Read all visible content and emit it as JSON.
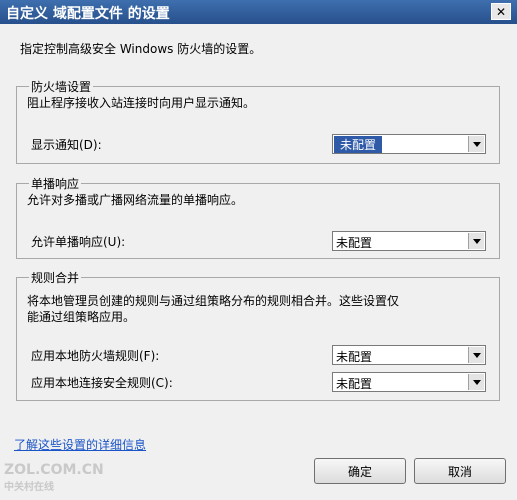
{
  "window": {
    "title": "自定义 域配置文件 的设置",
    "close_glyph": "✕"
  },
  "description": "指定控制高级安全 Windows 防火墙的设置。",
  "groups": [
    {
      "title": "防火墙设置",
      "description": "阻止程序接收入站连接时向用户显示通知。",
      "rows": [
        {
          "label": "显示通知(D):",
          "value": "未配置"
        }
      ]
    },
    {
      "title": "单播响应",
      "description": "允许对多播或广播网络流量的单播响应。",
      "rows": [
        {
          "label": "允许单播响应(U):",
          "value": "未配置"
        }
      ]
    },
    {
      "title": "规则合并",
      "description_lines": [
        "将本地管理员创建的规则与通过组策略分布的规则相合并。这些设置仅",
        "能通过组策略应用。"
      ],
      "rows": [
        {
          "label": "应用本地防火墙规则(F):",
          "value": "未配置"
        },
        {
          "label": "应用本地连接安全规则(C):",
          "value": "未配置"
        }
      ]
    }
  ],
  "link": "了解这些设置的详细信息",
  "buttons": {
    "ok": "确定",
    "cancel": "取消"
  },
  "watermark": {
    "main": "ZOL.COM.CN",
    "sub": "中关村在线"
  }
}
